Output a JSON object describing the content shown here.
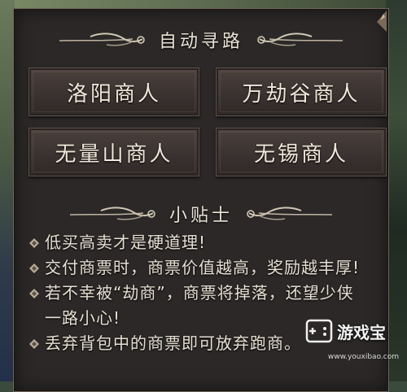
{
  "auto_path": {
    "title": "自动寻路",
    "merchants": [
      {
        "label": "洛阳商人"
      },
      {
        "label": "万劫谷商人"
      },
      {
        "label": "无量山商人"
      },
      {
        "label": "无锡商人"
      }
    ]
  },
  "tips": {
    "title": "小贴士",
    "items": [
      {
        "text": "低买高卖才是硬道理!"
      },
      {
        "text": "交付商票时，商票价值越高，奖励越丰厚!"
      },
      {
        "text": "若不幸被“劫商”，商票将掉落，还望少侠一路小心!"
      },
      {
        "text": "丢弃背包中的商票即可放弃跑商。"
      }
    ]
  },
  "watermark": {
    "name": "游戏宝",
    "url": "www.youxibao.com"
  },
  "colors": {
    "panel_bg": "#2b2827",
    "text": "#efe7d9",
    "button_bg": "#3b3331"
  }
}
